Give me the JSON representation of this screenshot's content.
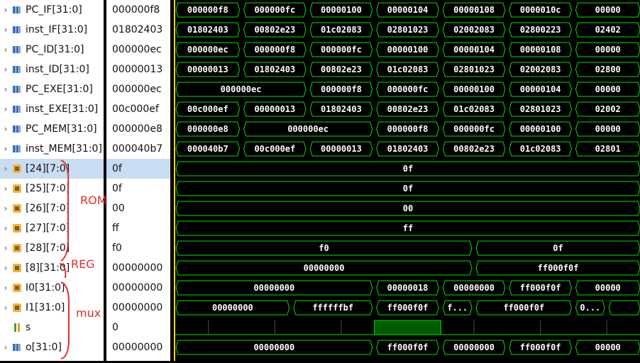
{
  "signals": [
    {
      "name": "PC_IF[31:0]",
      "value": "000000f8",
      "type": "bus",
      "expand": true,
      "segments": [
        [
          0,
          100,
          "000000f8"
        ],
        [
          100,
          200,
          "000000fc"
        ],
        [
          200,
          300,
          "00000100"
        ],
        [
          300,
          400,
          "00000104"
        ],
        [
          400,
          500,
          "00000108"
        ],
        [
          500,
          600,
          "0000010c"
        ],
        [
          600,
          700,
          "00000"
        ]
      ]
    },
    {
      "name": "inst_IF[31:0]",
      "value": "01802403",
      "type": "bus",
      "expand": true,
      "segments": [
        [
          0,
          100,
          "01802403"
        ],
        [
          100,
          200,
          "00802e23"
        ],
        [
          200,
          300,
          "01c02083"
        ],
        [
          300,
          400,
          "02801023"
        ],
        [
          400,
          500,
          "02002083"
        ],
        [
          500,
          600,
          "02800223"
        ],
        [
          600,
          700,
          "02402"
        ]
      ]
    },
    {
      "name": "PC_ID[31:0]",
      "value": "000000ec",
      "type": "bus",
      "expand": true,
      "segments": [
        [
          0,
          100,
          "000000ec"
        ],
        [
          100,
          200,
          "000000f8"
        ],
        [
          200,
          300,
          "000000fc"
        ],
        [
          300,
          400,
          "00000100"
        ],
        [
          400,
          500,
          "00000104"
        ],
        [
          500,
          600,
          "00000108"
        ],
        [
          600,
          700,
          "00000"
        ]
      ]
    },
    {
      "name": "inst_ID[31:0]",
      "value": "00000013",
      "type": "bus",
      "expand": true,
      "segments": [
        [
          0,
          100,
          "00000013"
        ],
        [
          100,
          200,
          "01802403"
        ],
        [
          200,
          300,
          "00802e23"
        ],
        [
          300,
          400,
          "01c02083"
        ],
        [
          400,
          500,
          "02801023"
        ],
        [
          500,
          600,
          "02002083"
        ],
        [
          600,
          700,
          "02800"
        ]
      ]
    },
    {
      "name": "PC_EXE[31:0]",
      "value": "000000ec",
      "type": "bus",
      "expand": true,
      "segments": [
        [
          0,
          200,
          "000000ec"
        ],
        [
          200,
          300,
          "000000f8"
        ],
        [
          300,
          400,
          "000000fc"
        ],
        [
          400,
          500,
          "00000100"
        ],
        [
          500,
          600,
          "00000104"
        ],
        [
          600,
          700,
          "00000"
        ]
      ]
    },
    {
      "name": "inst_EXE[31:0]",
      "value": "00c000ef",
      "type": "bus",
      "expand": true,
      "segments": [
        [
          0,
          100,
          "00c000ef"
        ],
        [
          100,
          200,
          "00000013"
        ],
        [
          200,
          300,
          "01802403"
        ],
        [
          300,
          400,
          "00802e23"
        ],
        [
          400,
          500,
          "01c02083"
        ],
        [
          500,
          600,
          "02801023"
        ],
        [
          600,
          700,
          "02002"
        ]
      ]
    },
    {
      "name": "PC_MEM[31:0]",
      "value": "000000e8",
      "type": "bus",
      "expand": true,
      "segments": [
        [
          0,
          100,
          "000000e8"
        ],
        [
          100,
          300,
          "000000ec"
        ],
        [
          300,
          400,
          "000000f8"
        ],
        [
          400,
          500,
          "000000fc"
        ],
        [
          500,
          600,
          "00000100"
        ],
        [
          600,
          700,
          "00000"
        ]
      ]
    },
    {
      "name": "inst_MEM[31:0]",
      "value": "000040b7",
      "type": "bus",
      "expand": true,
      "segments": [
        [
          0,
          100,
          "000040b7"
        ],
        [
          100,
          200,
          "00c000ef"
        ],
        [
          200,
          300,
          "00000013"
        ],
        [
          300,
          400,
          "01802403"
        ],
        [
          400,
          500,
          "00802e23"
        ],
        [
          500,
          600,
          "01c02083"
        ],
        [
          600,
          700,
          "02801"
        ]
      ]
    },
    {
      "name": "[24][7:0]",
      "value": "0f",
      "type": "mem",
      "expand": true,
      "selected": true,
      "segments": [
        [
          0,
          700,
          "0f"
        ]
      ]
    },
    {
      "name": "[25][7:0]",
      "value": "0f",
      "type": "mem",
      "expand": true,
      "segments": [
        [
          0,
          700,
          "0f"
        ]
      ]
    },
    {
      "name": "[26][7:0]",
      "value": "00",
      "type": "mem",
      "expand": true,
      "segments": [
        [
          0,
          700,
          "00"
        ]
      ]
    },
    {
      "name": "[27][7:0]",
      "value": "ff",
      "type": "mem",
      "expand": true,
      "segments": [
        [
          0,
          700,
          "ff"
        ]
      ]
    },
    {
      "name": "[28][7:0]",
      "value": "f0",
      "type": "mem",
      "expand": true,
      "segments": [
        [
          0,
          450,
          "f0"
        ],
        [
          450,
          700,
          "0f"
        ]
      ]
    },
    {
      "name": "[8][31:0]",
      "value": "00000000",
      "type": "mem",
      "expand": true,
      "segments": [
        [
          0,
          450,
          "00000000"
        ],
        [
          450,
          700,
          "ff000f0f"
        ]
      ]
    },
    {
      "name": "I0[31:0]",
      "value": "00000000",
      "type": "mem",
      "expand": true,
      "segments": [
        [
          0,
          300,
          "00000000"
        ],
        [
          300,
          400,
          "00000018"
        ],
        [
          400,
          500,
          "00000000"
        ],
        [
          500,
          600,
          "ff000f0f"
        ],
        [
          600,
          700,
          "00000"
        ]
      ]
    },
    {
      "name": "I1[31:0]",
      "value": "00000000",
      "type": "mem",
      "expand": true,
      "segments": [
        [
          0,
          175,
          "00000000"
        ],
        [
          175,
          300,
          "ffffffbf"
        ],
        [
          300,
          400,
          "ff000f0f"
        ],
        [
          400,
          450,
          "f..."
        ],
        [
          450,
          600,
          "ff000f0f"
        ],
        [
          600,
          650,
          "0..."
        ],
        [
          650,
          700,
          ""
        ]
      ]
    },
    {
      "name": "s",
      "value": "0",
      "type": "bit",
      "expand": false,
      "bit": [
        [
          0,
          300,
          0
        ],
        [
          300,
          400,
          1
        ],
        [
          400,
          700,
          0
        ]
      ]
    },
    {
      "name": "o[31:0]",
      "value": "00000000",
      "type": "bus",
      "expand": true,
      "segments": [
        [
          0,
          300,
          "00000000"
        ],
        [
          300,
          400,
          "ff000f0f"
        ],
        [
          400,
          500,
          "00000000"
        ],
        [
          500,
          600,
          "ff000f0f"
        ],
        [
          600,
          700,
          "00000"
        ]
      ]
    }
  ],
  "annotations": {
    "rom": "ROM",
    "reg": "REG",
    "mux": "mux"
  },
  "colors": {
    "wave": "#00e000",
    "text": "#ffffff",
    "bit_high": "#005c00",
    "cursor": "#ffd700"
  }
}
